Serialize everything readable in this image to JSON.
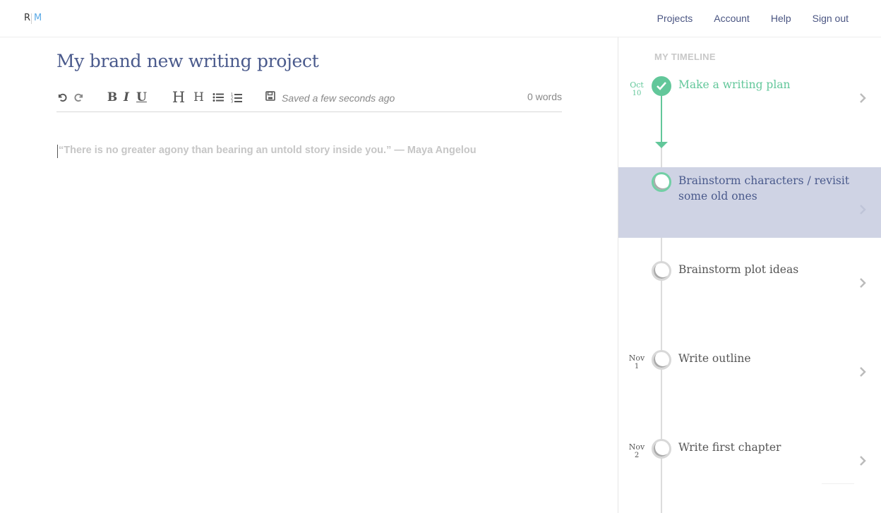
{
  "header": {
    "logo_r": "R",
    "logo_m": "M",
    "nav": [
      "Projects",
      "Account",
      "Help",
      "Sign out"
    ]
  },
  "editor": {
    "title": "My brand new writing project",
    "saved_status": "Saved a few seconds ago",
    "word_count": "0 words",
    "placeholder": "“There is no greater agony than bearing an untold story inside you.” — Maya Angelou",
    "toolbar": {
      "bold": "B",
      "italic": "I",
      "underline": "U",
      "heading_large": "H",
      "heading_small": "H"
    }
  },
  "timeline": {
    "heading": "MY TIMELINE",
    "items": [
      {
        "month": "Oct",
        "day": "10",
        "label": "Make a writing plan",
        "status": "done"
      },
      {
        "month": "",
        "day": "",
        "label": "Brainstorm characters / revisit some old ones",
        "status": "active"
      },
      {
        "month": "",
        "day": "",
        "label": "Brainstorm plot ideas",
        "status": "pending"
      },
      {
        "month": "Nov",
        "day": "1",
        "label": "Write outline",
        "status": "pending"
      },
      {
        "month": "Nov",
        "day": "2",
        "label": "Write first chapter",
        "status": "pending"
      }
    ]
  },
  "colors": {
    "accent_blue": "#4a5a8c",
    "done_green": "#62c79a",
    "active_bg": "#cfd3e4"
  },
  "icons": [
    "undo-icon",
    "redo-icon",
    "bullet-list-icon",
    "numbered-list-icon",
    "save-icon",
    "checkmark-icon",
    "chevron-right-icon"
  ]
}
